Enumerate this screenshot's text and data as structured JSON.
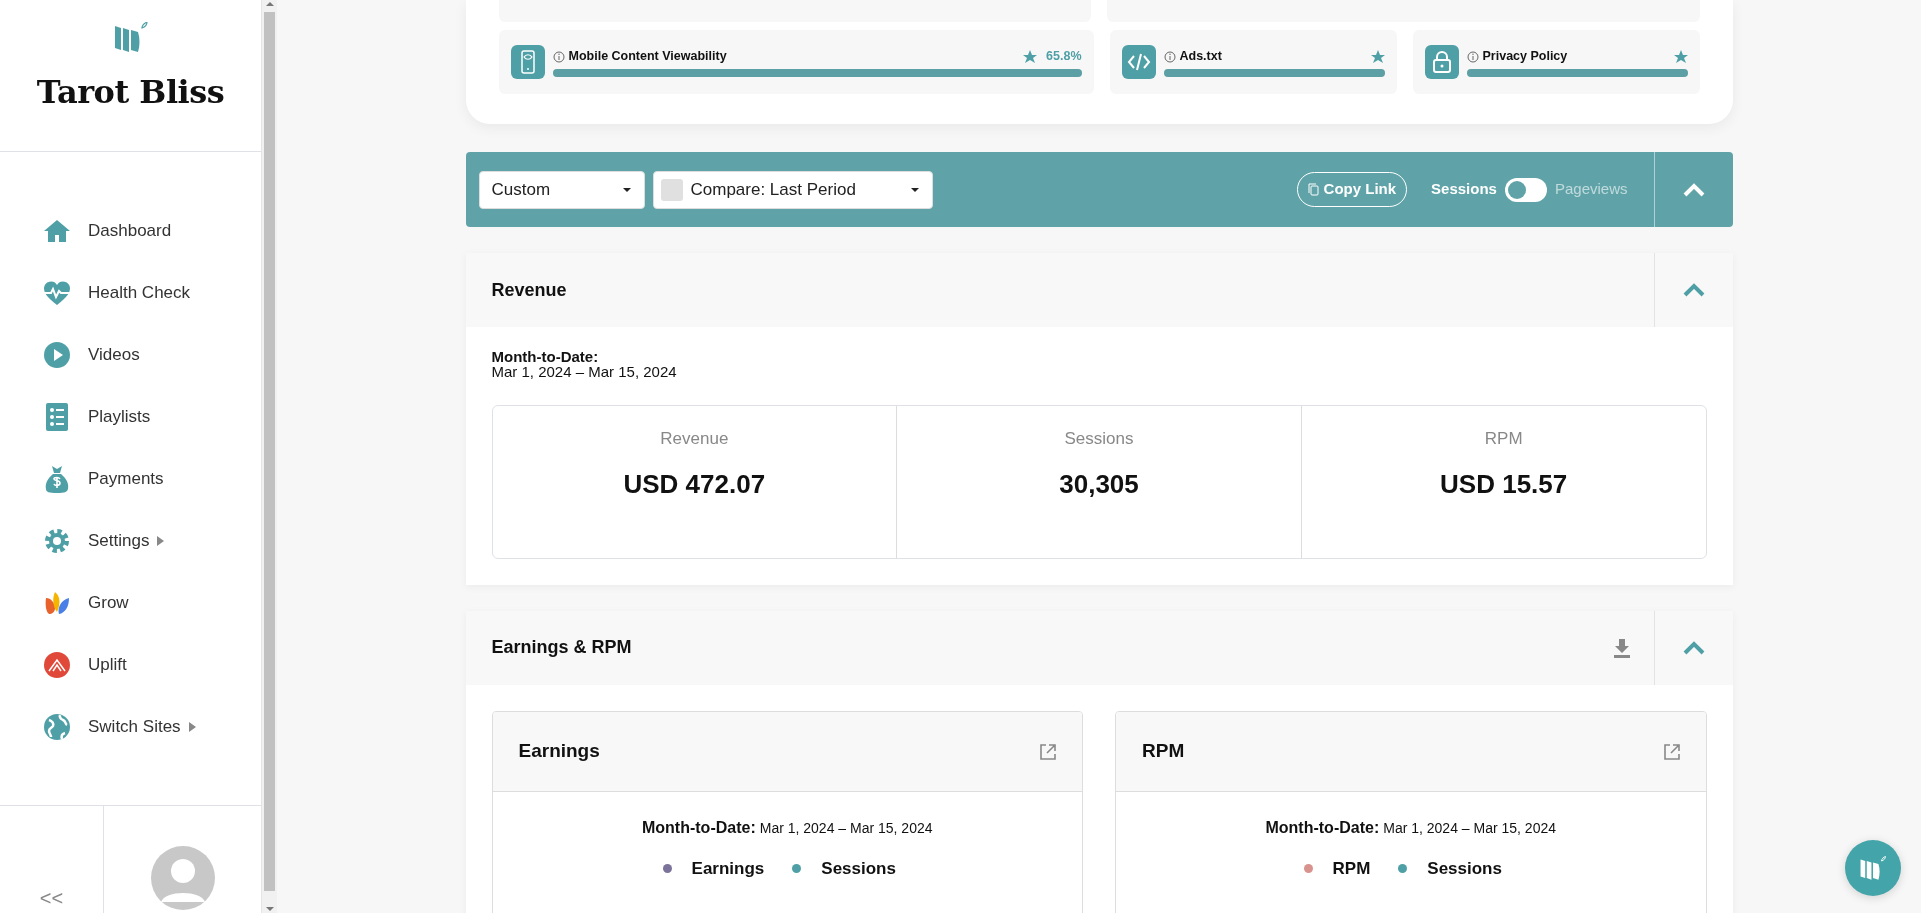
{
  "sidebar": {
    "site_title": "Tarot Bliss",
    "items": [
      {
        "label": "Dashboard",
        "has_submenu": false
      },
      {
        "label": "Health Check",
        "has_submenu": false
      },
      {
        "label": "Videos",
        "has_submenu": false
      },
      {
        "label": "Playlists",
        "has_submenu": false
      },
      {
        "label": "Payments",
        "has_submenu": false
      },
      {
        "label": "Settings",
        "has_submenu": true
      },
      {
        "label": "Grow",
        "has_submenu": false
      },
      {
        "label": "Uplift",
        "has_submenu": false
      },
      {
        "label": "Switch Sites",
        "has_submenu": true
      }
    ],
    "collapse_label": "<<"
  },
  "health_checks": [
    {
      "name": "Mobile Content Viewability",
      "level": 1,
      "score": "65.8%"
    },
    {
      "name": "Ads.txt",
      "level": 1
    },
    {
      "name": "Privacy Policy",
      "level": 1
    }
  ],
  "filter_bar": {
    "date_range": "Custom",
    "compare": "Compare: Last Period",
    "compare_checked": false,
    "copy_link": "Copy Link",
    "toggle": {
      "left_label": "Sessions",
      "right_label": "Pageviews",
      "on": false
    }
  },
  "revenue": {
    "title": "Revenue",
    "period_label": "Month-to-Date:",
    "period": "Mar 1, 2024 – Mar 15, 2024",
    "stats": [
      {
        "label": "Revenue",
        "value": "USD 472.07"
      },
      {
        "label": "Sessions",
        "value": "30,305"
      },
      {
        "label": "RPM",
        "value": "USD 15.57"
      }
    ]
  },
  "earnings_rpm": {
    "title": "Earnings & RPM",
    "cards": [
      {
        "title": "Earnings",
        "period_label": "Month-to-Date:",
        "period": "Mar 1, 2024 – Mar 15, 2024",
        "legend": [
          {
            "name": "Earnings",
            "color": "#7b7399"
          },
          {
            "name": "Sessions",
            "color": "#4fa0a6"
          }
        ]
      },
      {
        "title": "RPM",
        "period_label": "Month-to-Date:",
        "period": "Mar 1, 2024 – Mar 15, 2024",
        "legend": [
          {
            "name": "RPM",
            "color": "#d9938e"
          },
          {
            "name": "Sessions",
            "color": "#4fa0a6"
          }
        ]
      }
    ]
  }
}
